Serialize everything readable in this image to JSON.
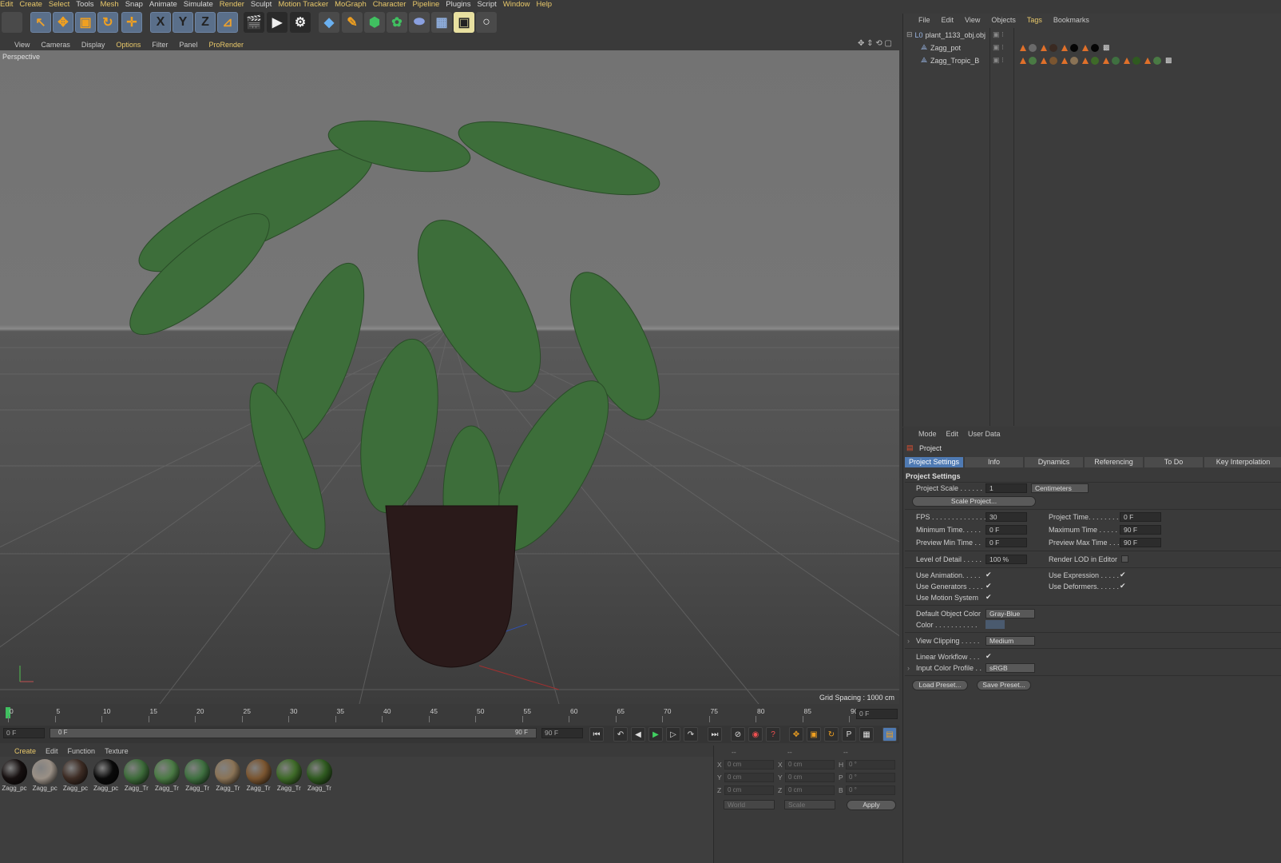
{
  "menubar": [
    "Edit",
    "Create",
    "Select",
    "Tools",
    "Mesh",
    "Snap",
    "Animate",
    "Simulate",
    "Render",
    "Sculpt",
    "Motion Tracker",
    "MoGraph",
    "Character",
    "Pipeline",
    "Plugins",
    "Script",
    "Window",
    "Help"
  ],
  "toolbar": {
    "x": "X",
    "y": "Y",
    "z": "Z"
  },
  "viewport": {
    "menu": [
      "View",
      "Cameras",
      "Display",
      "Options",
      "Filter",
      "Panel",
      "ProRender"
    ],
    "label": "Perspective",
    "grid_spacing": "Grid Spacing : 1000 cm"
  },
  "timeline": {
    "ticks": [
      "0",
      "5",
      "10",
      "15",
      "20",
      "25",
      "30",
      "35",
      "40",
      "45",
      "50",
      "55",
      "60",
      "65",
      "70",
      "75",
      "80",
      "85",
      "90"
    ],
    "current_frame": "0 F",
    "start_field": "0 F",
    "range_start": "0 F",
    "range_end": "90 F",
    "end_field": "90 F"
  },
  "material_manager": {
    "menu": [
      "Create",
      "Edit",
      "Function",
      "Texture"
    ],
    "materials": [
      {
        "name": "Zagg_pc",
        "color": "#161010"
      },
      {
        "name": "Zagg_pc",
        "color": "#9a9086"
      },
      {
        "name": "Zagg_pc",
        "color": "#3d2c24"
      },
      {
        "name": "Zagg_pc",
        "color": "#0a0a0a"
      },
      {
        "name": "Zagg_Tr",
        "color": "#3d6b3a"
      },
      {
        "name": "Zagg_Tr",
        "color": "#4a7a44"
      },
      {
        "name": "Zagg_Tr",
        "color": "#3f7040"
      },
      {
        "name": "Zagg_Tr",
        "color": "#8a7356"
      },
      {
        "name": "Zagg_Tr",
        "color": "#7a5530"
      },
      {
        "name": "Zagg_Tr",
        "color": "#3e6a28"
      },
      {
        "name": "Zagg_Tr",
        "color": "#2f5a20"
      }
    ]
  },
  "coordinates": {
    "headers": [
      "--",
      "--",
      "--"
    ],
    "rows": [
      {
        "a": "X",
        "av": "0 cm",
        "b": "X",
        "bv": "0 cm",
        "c": "H",
        "cv": "0 °"
      },
      {
        "a": "Y",
        "av": "0 cm",
        "b": "Y",
        "bv": "0 cm",
        "c": "P",
        "cv": "0 °"
      },
      {
        "a": "Z",
        "av": "0 cm",
        "b": "Z",
        "bv": "0 cm",
        "c": "B",
        "cv": "0 °"
      }
    ],
    "world": "World",
    "scale": "Scale",
    "apply": "Apply"
  },
  "object_manager": {
    "menu": [
      "File",
      "Edit",
      "View",
      "Objects",
      "Tags",
      "Bookmarks"
    ],
    "objects": [
      {
        "name": "plant_1133_obj.obj"
      },
      {
        "name": "Zagg_pot"
      },
      {
        "name": "Zagg_Tropic_B"
      }
    ]
  },
  "attributes": {
    "menu": [
      "Mode",
      "Edit",
      "User Data"
    ],
    "title": "Project",
    "tabs": [
      "Project Settings",
      "Info",
      "Dynamics",
      "Referencing",
      "To Do",
      "Key Interpolation"
    ],
    "section": "Project Settings",
    "project_scale_label": "Project Scale . . . . . .",
    "project_scale_value": "1",
    "project_scale_unit": "Centimeters",
    "scale_project_btn": "Scale Project...",
    "fps_label": "FPS . . . . . . . . . . . . . .",
    "fps_value": "30",
    "project_time_label": "Project Time. . . . . . . .",
    "project_time_value": "0 F",
    "min_time_label": "Minimum Time. . . . .",
    "min_time_value": "0 F",
    "max_time_label": "Maximum Time . . . . .",
    "max_time_value": "90 F",
    "prev_min_label": "Preview Min Time . .",
    "prev_min_value": "0 F",
    "prev_max_label": "Preview Max Time . . .",
    "prev_max_value": "90 F",
    "lod_label": "Level of Detail . . . . .",
    "lod_value": "100 %",
    "render_lod_label": "Render LOD in Editor",
    "use_anim_label": "Use Animation. . . . .",
    "use_expr_label": "Use Expression . . . . .",
    "use_gen_label": "Use Generators . . . .",
    "use_def_label": "Use Deformers. . . . . .",
    "use_motion_label": "Use Motion System",
    "def_color_label": "Default Object Color",
    "def_color_value": "Gray-Blue",
    "color_label": "Color . . . . . . . . . . .",
    "view_clip_label": "View Clipping . . . . .",
    "view_clip_value": "Medium",
    "linear_label": "Linear Workflow . . .",
    "input_profile_label": "Input Color Profile . .",
    "input_profile_value": "sRGB",
    "load_preset": "Load Preset...",
    "save_preset": "Save Preset...",
    "check": "✔"
  }
}
